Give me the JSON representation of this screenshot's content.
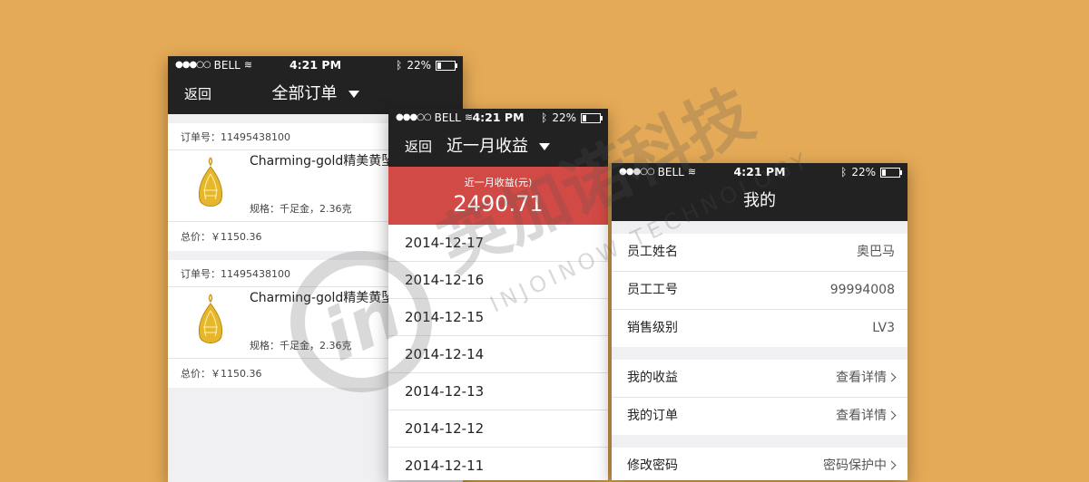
{
  "status": {
    "carrier": "BELL",
    "time": "4:21 PM",
    "battery": "22%"
  },
  "phone1": {
    "back": "返回",
    "title": "全部订单",
    "orders": [
      {
        "order_no": "订单号：11495438100",
        "name": "Charming-gold精美黄坠",
        "spec": "规格：千足金，2.36克",
        "total": "总价：￥1150.36"
      },
      {
        "order_no": "订单号：11495438100",
        "name": "Charming-gold精美黄坠",
        "spec": "规格：千足金，2.36克",
        "total": "总价：￥1150.36"
      }
    ]
  },
  "phone2": {
    "back": "返回",
    "title": "近一月收益",
    "income_label": "近一月收益(元)",
    "income_value": "2490.71",
    "dates": [
      "2014-12-17",
      "2014-12-16",
      "2014-12-15",
      "2014-12-14",
      "2014-12-13",
      "2014-12-12",
      "2014-12-11"
    ]
  },
  "phone3": {
    "title": "我的",
    "info": [
      {
        "key": "员工姓名",
        "value": "奥巴马"
      },
      {
        "key": "员工工号",
        "value": "99994008"
      },
      {
        "key": "销售级别",
        "value": "LV3"
      }
    ],
    "links": [
      {
        "key": "我的收益",
        "value": "查看详情"
      },
      {
        "key": "我的订单",
        "value": "查看详情"
      }
    ],
    "settings": [
      {
        "key": "修改密码",
        "value": "密码保护中"
      }
    ]
  },
  "watermark": {
    "cn": "英加诺科技",
    "en": "INJOINOW TECHNOLOGY",
    "logo": "in"
  },
  "colors": {
    "background": "#e5aa57",
    "bar": "#222222",
    "accent_red": "#d24a45"
  }
}
